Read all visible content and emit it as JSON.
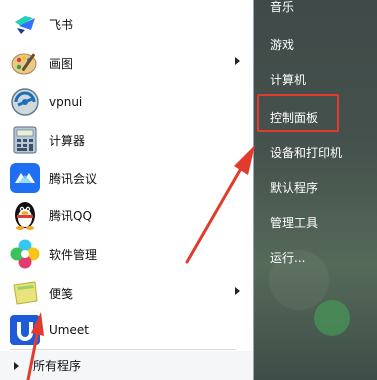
{
  "left_programs": [
    {
      "label": "飞书",
      "icon": "feishu-icon",
      "has_submenu": false
    },
    {
      "label": "画图",
      "icon": "paint-palette-icon",
      "has_submenu": true
    },
    {
      "label": "vpnui",
      "icon": "vpn-icon",
      "has_submenu": false
    },
    {
      "label": "计算器",
      "icon": "calculator-icon",
      "has_submenu": false
    },
    {
      "label": "腾讯会议",
      "icon": "tencent-meeting-icon",
      "has_submenu": false
    },
    {
      "label": "腾讯QQ",
      "icon": "qq-penguin-icon",
      "has_submenu": false
    },
    {
      "label": "软件管理",
      "icon": "software-manager-icon",
      "has_submenu": false
    },
    {
      "label": "便笺",
      "icon": "sticky-note-icon",
      "has_submenu": true
    },
    {
      "label": "Umeet",
      "icon": "umeet-icon",
      "has_submenu": false
    }
  ],
  "all_programs_label": "所有程序",
  "right_items": [
    {
      "label": "音乐"
    },
    {
      "label": "游戏"
    },
    {
      "label": "计算机"
    },
    {
      "label": "控制面板"
    },
    {
      "label": "设备和打印机"
    },
    {
      "label": "默认程序"
    },
    {
      "label": "管理工具"
    },
    {
      "label": "运行..."
    }
  ],
  "colors": {
    "highlight_box": "#e23b2e",
    "annotation_arrow": "#e23b2e"
  }
}
